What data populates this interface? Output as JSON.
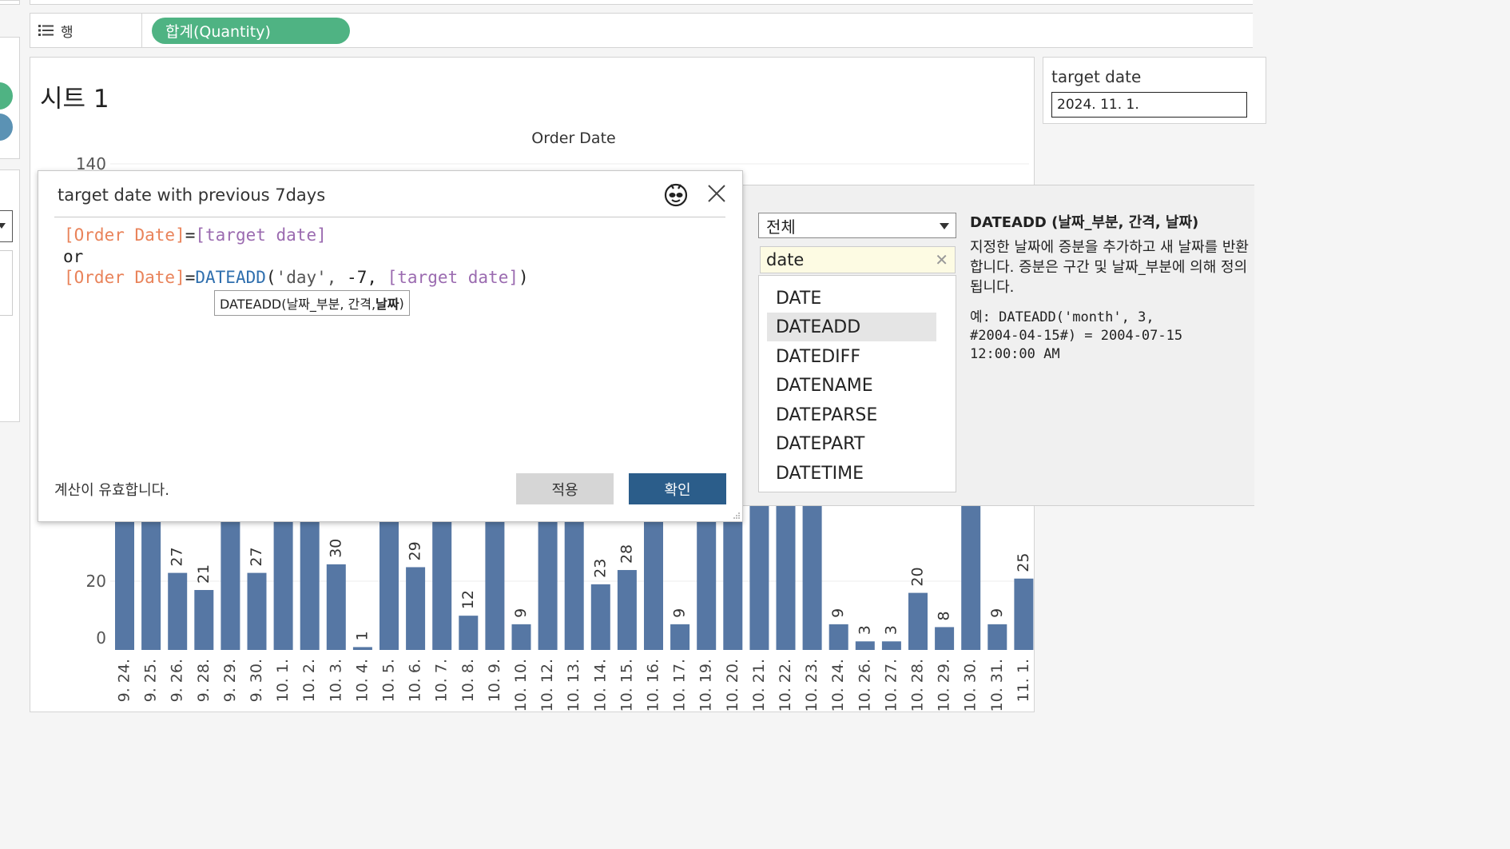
{
  "rows_shelf": {
    "label": "행",
    "pill": "합계(Quantity)"
  },
  "sheet": {
    "title": "시트 1",
    "column_header": "Order Date"
  },
  "parameter": {
    "label": "target date",
    "value": "2024. 11. 1."
  },
  "calc_dialog": {
    "title": "target date with previous 7days",
    "code": {
      "l1_field": "[Order Date]",
      "l1_eq": "=",
      "l1_param": "[target date]",
      "l2": "or",
      "l3_field": "[Order Date]",
      "l3_eq": "=",
      "l3_func": "DATEADD",
      "l3_open": "(",
      "l3_str": "'day',",
      "l3_num": " -7, ",
      "l3_param": "[target date]",
      "l3_close": ")"
    },
    "tooltip_prefix": "DATEADD(날짜_부분, 간격, ",
    "tooltip_bold": "날짜",
    "tooltip_suffix": ")",
    "status": "계산이 유효합니다.",
    "apply_label": "적용",
    "ok_label": "확인"
  },
  "function_panel": {
    "category": "전체",
    "search": "date",
    "items": [
      "DATE",
      "DATEADD",
      "DATEDIFF",
      "DATENAME",
      "DATEPARSE",
      "DATEPART",
      "DATETIME"
    ],
    "selected_index": 1,
    "signature": "DATEADD (날짜_부분, 간격, 날짜)",
    "description": "지정한 날짜에 증분을 추가하고 새 날짜를 반환합니다. 증분은 구간 및 날짜_부분에 의해 정의됩니다.",
    "example_l1": "예: DATEADD('month', 3,",
    "example_l2": "#2004-04-15#) = 2004-07-15",
    "example_l3": "12:00:00 AM"
  },
  "chart_data": {
    "type": "bar",
    "title": "Order Date",
    "ylim": [
      0,
      140
    ],
    "y_ticks_visible": [
      140,
      20,
      0
    ],
    "categories": [
      "9. 24.",
      "9. 25.",
      "9. 26.",
      "9. 28.",
      "9. 29.",
      "9. 30.",
      "10. 1.",
      "10. 2.",
      "10. 3.",
      "10. 4.",
      "10. 5.",
      "10. 6.",
      "10. 7.",
      "10. 8.",
      "10. 9.",
      "10. 10.",
      "10. 12.",
      "10. 13.",
      "10. 14.",
      "10. 15.",
      "10. 16.",
      "10. 17.",
      "10. 19.",
      "10. 20.",
      "10. 21.",
      "10. 22.",
      "10. 23.",
      "10. 24.",
      "10. 26.",
      "10. 27.",
      "10. 28.",
      "10. 29.",
      "10. 30.",
      "10. 31.",
      "11. 1."
    ],
    "values": [
      null,
      null,
      27,
      21,
      null,
      27,
      null,
      null,
      30,
      1,
      null,
      29,
      null,
      12,
      null,
      9,
      null,
      null,
      23,
      28,
      null,
      9,
      null,
      null,
      null,
      null,
      null,
      9,
      3,
      3,
      20,
      8,
      null,
      9,
      25
    ],
    "value_labels": [
      "",
      "",
      "27",
      "21",
      "",
      "27",
      "",
      "",
      "30",
      "1",
      "",
      "29",
      "",
      "12",
      "",
      "9",
      "",
      "",
      "23",
      "28",
      "",
      "9",
      "",
      "",
      "",
      "",
      "",
      "9",
      "3",
      "3",
      "20",
      "8",
      "",
      "9",
      "25"
    ],
    "color": "#5677a4"
  }
}
